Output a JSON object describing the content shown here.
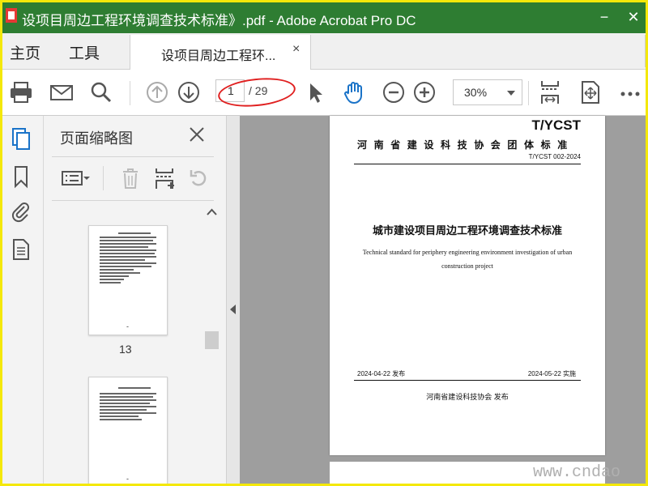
{
  "window": {
    "title": "设项目周边工程环境调查技术标准》.pdf - Adobe Acrobat Pro DC",
    "minimize_glyph": "−",
    "close_glyph": "✕"
  },
  "tabs": {
    "home": "主页",
    "tools": "工具",
    "document": "设项目周边工程环...",
    "close_glyph": "×"
  },
  "toolbar": {
    "current_page": "1",
    "page_total": "/ 29",
    "zoom": "30%",
    "icons": [
      "print-icon",
      "email-icon",
      "search-icon",
      "page-up-icon",
      "page-down-icon",
      "select-pointer-icon",
      "hand-icon",
      "zoom-out-icon",
      "zoom-in-icon",
      "fit-page-icon",
      "scroll-mode-icon",
      "more-icon"
    ]
  },
  "panel": {
    "title": "页面缩略图",
    "thumbnails": [
      {
        "page": "13",
        "dash": "-"
      },
      {
        "page": "",
        "dash": "-"
      }
    ]
  },
  "document": {
    "code": "T/YCST",
    "association": "河南省建设科技协会团体标准",
    "standard_number": "T/YCST 002-2024",
    "title_cn": "城市建设项目周边工程环境调查技术标准",
    "title_en": "Technical standard for periphery engineering environment investigation of urban construction project",
    "publish_date": "2024-04-22 发布",
    "implement_date": "2024-05-22 实施",
    "publisher": "河南省建设科技协会   发布"
  },
  "watermark": "www.cndao",
  "colors": {
    "titlebar": "#2e7d32",
    "frame": "#f4e80a",
    "accent_blue": "#1a73c8",
    "annotation_red": "#e02020"
  }
}
